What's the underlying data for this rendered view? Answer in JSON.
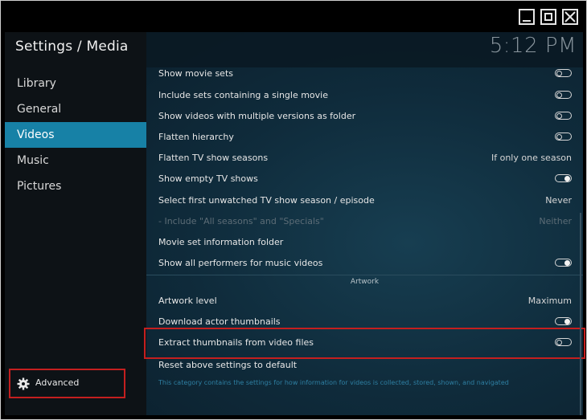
{
  "window_controls": {
    "minimize": "minimize",
    "maximize": "maximize",
    "close": "close"
  },
  "header": {
    "title": "Settings / Media",
    "clock": "5:12 PM"
  },
  "nav": [
    {
      "label": "Library"
    },
    {
      "label": "General"
    },
    {
      "label": "Videos",
      "active": true
    },
    {
      "label": "Music"
    },
    {
      "label": "Pictures"
    }
  ],
  "advanced": {
    "label": "Advanced",
    "icon": "gear-icon"
  },
  "settings": [
    {
      "label": "Show movie sets",
      "type": "toggle",
      "value": "off"
    },
    {
      "label": "Include sets containing a single movie",
      "type": "toggle",
      "value": "off"
    },
    {
      "label": "Show videos with multiple versions as folder",
      "type": "toggle",
      "value": "off"
    },
    {
      "label": "Flatten hierarchy",
      "type": "toggle",
      "value": "off"
    },
    {
      "label": "Flatten TV show seasons",
      "type": "value",
      "value": "If only one season"
    },
    {
      "label": "Show empty TV shows",
      "type": "toggle",
      "value": "on"
    },
    {
      "label": "Select first unwatched TV show season / episode",
      "type": "value",
      "value": "Never"
    },
    {
      "label": "- Include \"All seasons\" and \"Specials\"",
      "type": "value",
      "value": "Neither",
      "disabled": true
    },
    {
      "label": "Movie set information folder",
      "type": "none",
      "value": ""
    },
    {
      "label": "Show all performers for music videos",
      "type": "toggle",
      "value": "on"
    }
  ],
  "section_artwork": "Artwork",
  "artwork_settings": [
    {
      "label": "Artwork level",
      "type": "value",
      "value": "Maximum"
    },
    {
      "label": "Download actor thumbnails",
      "type": "toggle",
      "value": "on"
    },
    {
      "label": "Extract thumbnails from video files",
      "type": "toggle",
      "value": "off"
    }
  ],
  "reset_label": "Reset above settings to default",
  "footer_info": "This category contains the settings for how information for videos is collected, stored, shown, and navigated",
  "colors": {
    "accent": "#1781a6",
    "highlight_border": "#c41f1f"
  }
}
